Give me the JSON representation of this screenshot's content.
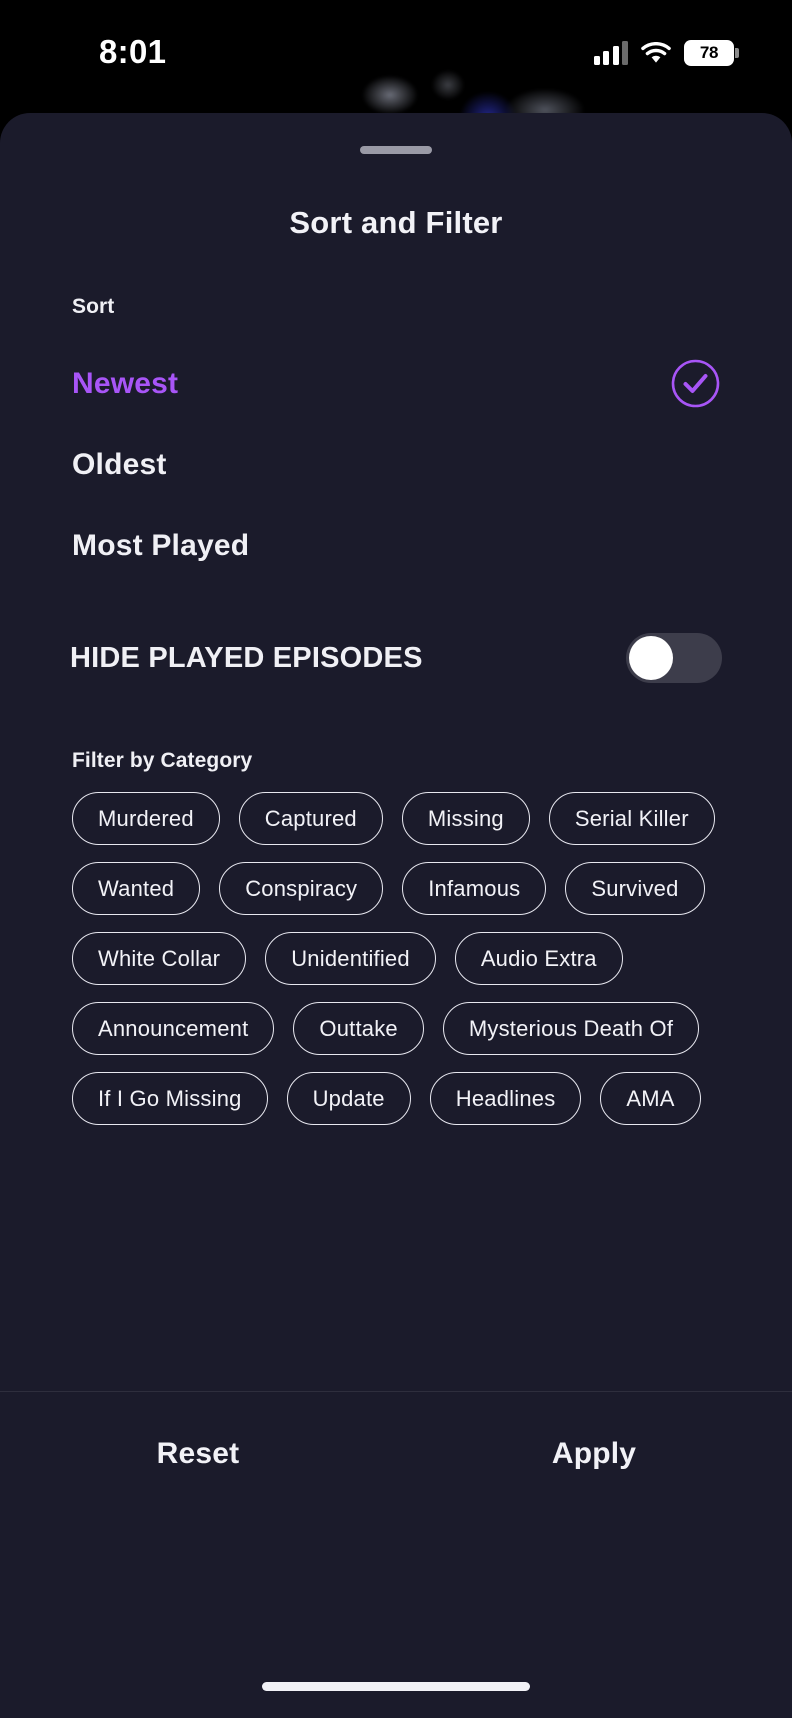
{
  "status_bar": {
    "time": "8:01",
    "cellular_icon": "cellular-bars-icon",
    "wifi_icon": "wifi-icon",
    "battery_level": "78"
  },
  "sheet": {
    "grabber": "drag-handle",
    "title": "Sort and Filter"
  },
  "sort": {
    "label": "Sort",
    "selected": "Newest",
    "options": [
      {
        "label": "Newest",
        "selected": true
      },
      {
        "label": "Oldest",
        "selected": false
      },
      {
        "label": "Most Played",
        "selected": false
      }
    ],
    "check_icon": "check-circle-icon"
  },
  "hide_played": {
    "label": "HIDE PLAYED EPISODES",
    "enabled": false
  },
  "filter": {
    "label": "Filter by Category",
    "categories": [
      {
        "label": "Murdered",
        "active": false
      },
      {
        "label": "Captured",
        "active": false
      },
      {
        "label": "Missing",
        "active": false
      },
      {
        "label": "Serial Killer",
        "active": false
      },
      {
        "label": "Wanted",
        "active": false
      },
      {
        "label": "Conspiracy",
        "active": false
      },
      {
        "label": "Infamous",
        "active": false
      },
      {
        "label": "Survived",
        "active": false
      },
      {
        "label": "White Collar",
        "active": false
      },
      {
        "label": "Unidentified",
        "active": false
      },
      {
        "label": "Audio Extra",
        "active": false
      },
      {
        "label": "Announcement",
        "active": false
      },
      {
        "label": "Outtake",
        "active": false
      },
      {
        "label": "Mysterious Death Of",
        "active": false
      },
      {
        "label": "If I Go Missing",
        "active": false
      },
      {
        "label": "Update",
        "active": false
      },
      {
        "label": "Headlines",
        "active": false
      },
      {
        "label": "AMA",
        "active": false
      }
    ]
  },
  "footer": {
    "reset_label": "Reset",
    "apply_label": "Apply"
  },
  "colors": {
    "accent_purple": "#a855f7",
    "sheet_background": "#1b1b2b",
    "text_primary": "#f2f2f7",
    "toggle_track_off": "#3d3d4b"
  }
}
